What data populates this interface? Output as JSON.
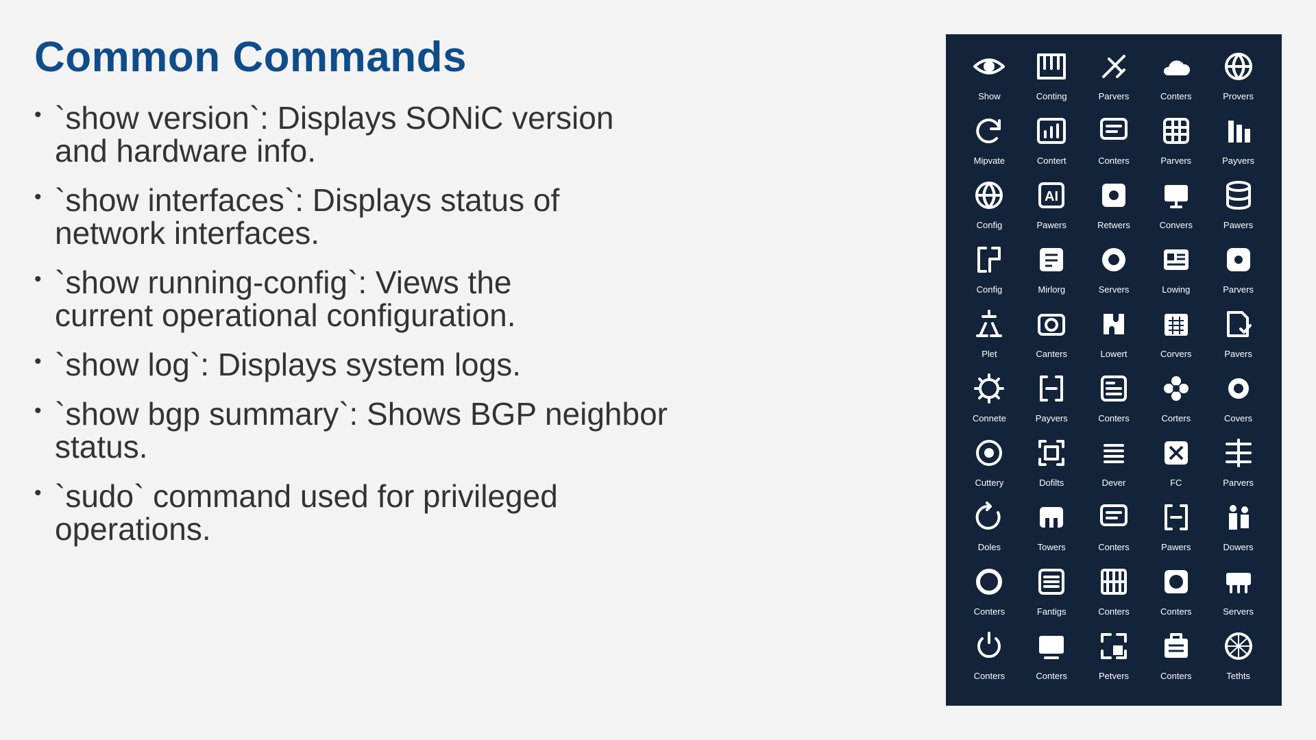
{
  "slide": {
    "title": "Common Commands",
    "bullets": [
      {
        "line1": "`show version`: Displays SONiC version",
        "line2": "and hardware info."
      },
      {
        "line1": "`show interfaces`: Displays status of",
        "line2": "network interfaces."
      },
      {
        "line1": "`show running-config`: Views the",
        "line2": "current operational configuration."
      },
      {
        "line1": "`show log`: Displays system logs.",
        "line2": ""
      },
      {
        "line1": "`show bgp summary`: Shows BGP neighbor",
        "line2": "status."
      },
      {
        "line1": "`sudo` command used for privileged",
        "line2": "operations."
      }
    ]
  },
  "icon_panel": {
    "background": "#13233a",
    "icons": [
      {
        "label": "Show",
        "icon": "eye-icon"
      },
      {
        "label": "Conting",
        "icon": "piano-icon"
      },
      {
        "label": "Parvers",
        "icon": "satellite-icon"
      },
      {
        "label": "Conters",
        "icon": "cloud-upload-icon"
      },
      {
        "label": "Provers",
        "icon": "globe-icon"
      },
      {
        "label": "Mipvate",
        "icon": "refresh-icon"
      },
      {
        "label": "Contert",
        "icon": "bar-chart-icon"
      },
      {
        "label": "Conters",
        "icon": "message-icon"
      },
      {
        "label": "Parvers",
        "icon": "grid-doc-icon"
      },
      {
        "label": "Payvers",
        "icon": "columns-icon"
      },
      {
        "label": "Config",
        "icon": "globe-icon"
      },
      {
        "label": "Pawers",
        "icon": "ai-icon"
      },
      {
        "label": "Retwers",
        "icon": "network-icon"
      },
      {
        "label": "Convers",
        "icon": "monitor-icon"
      },
      {
        "label": "Pawers",
        "icon": "database-icon"
      },
      {
        "label": "Config",
        "icon": "bracket-icon"
      },
      {
        "label": "Mirlorg",
        "icon": "text-doc-icon"
      },
      {
        "label": "Servers",
        "icon": "web-icon"
      },
      {
        "label": "Lowing",
        "icon": "id-card-icon"
      },
      {
        "label": "Parvers",
        "icon": "gear-network-icon"
      },
      {
        "label": "Plet",
        "icon": "flask-icon"
      },
      {
        "label": "Canters",
        "icon": "camera-icon"
      },
      {
        "label": "Lowert",
        "icon": "puzzle-icon"
      },
      {
        "label": "Corvers",
        "icon": "calendar-icon"
      },
      {
        "label": "Pavers",
        "icon": "doc-check-icon"
      },
      {
        "label": "Connete",
        "icon": "gear-icon"
      },
      {
        "label": "Payvers",
        "icon": "bracket-square-icon"
      },
      {
        "label": "Conters",
        "icon": "note-icon"
      },
      {
        "label": "Corters",
        "icon": "flower-icon"
      },
      {
        "label": "Covers",
        "icon": "sun-gear-icon"
      },
      {
        "label": "Cuttery",
        "icon": "spiral-icon"
      },
      {
        "label": "Dofilts",
        "icon": "focus-icon"
      },
      {
        "label": "Dever",
        "icon": "list-icon"
      },
      {
        "label": "FC",
        "icon": "cross-icon"
      },
      {
        "label": "Parvers",
        "icon": "split-icon"
      },
      {
        "label": "Doles",
        "icon": "loop-icon"
      },
      {
        "label": "Towers",
        "icon": "table-icon"
      },
      {
        "label": "Conters",
        "icon": "message-icon"
      },
      {
        "label": "Pawers",
        "icon": "bracket-square-icon"
      },
      {
        "label": "Dowers",
        "icon": "people-icon"
      },
      {
        "label": "Conters",
        "icon": "cycle-icon"
      },
      {
        "label": "Fantigs",
        "icon": "list-doc-icon"
      },
      {
        "label": "Conters",
        "icon": "grid-icon"
      },
      {
        "label": "Conters",
        "icon": "world-icon"
      },
      {
        "label": "Servers",
        "icon": "server-icon"
      },
      {
        "label": "Conters",
        "icon": "power-icon"
      },
      {
        "label": "Conters",
        "icon": "screen-icon"
      },
      {
        "label": "Petvers",
        "icon": "frame-icon"
      },
      {
        "label": "Conters",
        "icon": "building-icon"
      },
      {
        "label": "Tethts",
        "icon": "web-globe-icon"
      }
    ]
  }
}
